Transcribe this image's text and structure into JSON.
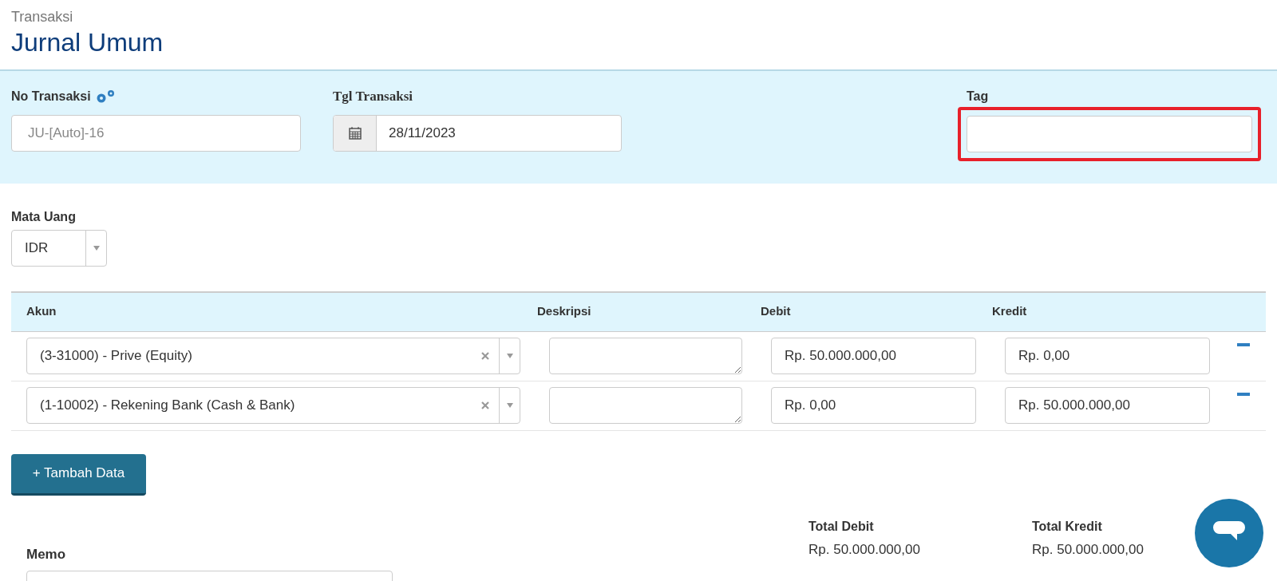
{
  "header": {
    "breadcrumb": "Transaksi",
    "title": "Jurnal Umum"
  },
  "form": {
    "no_transaksi": {
      "label": "No Transaksi",
      "placeholder": "JU-[Auto]-16"
    },
    "tgl_transaksi": {
      "label": "Tgl Transaksi",
      "value": "28/11/2023"
    },
    "tag": {
      "label": "Tag",
      "highlighted": true
    }
  },
  "currency": {
    "label": "Mata Uang",
    "value": "IDR"
  },
  "table": {
    "columns": [
      "Akun",
      "Deskripsi",
      "Debit",
      "Kredit"
    ],
    "rows": [
      {
        "akun": "(3-31000) - Prive (Equity)",
        "debit": "Rp. 50.000.000,00",
        "kredit": "Rp. 0,00"
      },
      {
        "akun": "(1-10002) - Rekening Bank (Cash & Bank)",
        "debit": "Rp. 0,00",
        "kredit": "Rp. 50.000.000,00"
      }
    ]
  },
  "add_button": "+ Tambah Data",
  "memo": {
    "label": "Memo"
  },
  "totals": [
    {
      "label": "Total Debit",
      "value": "Rp. 50.000.000,00"
    },
    {
      "label": "Total Kredit",
      "value": "Rp. 50.000.000,00"
    }
  ]
}
